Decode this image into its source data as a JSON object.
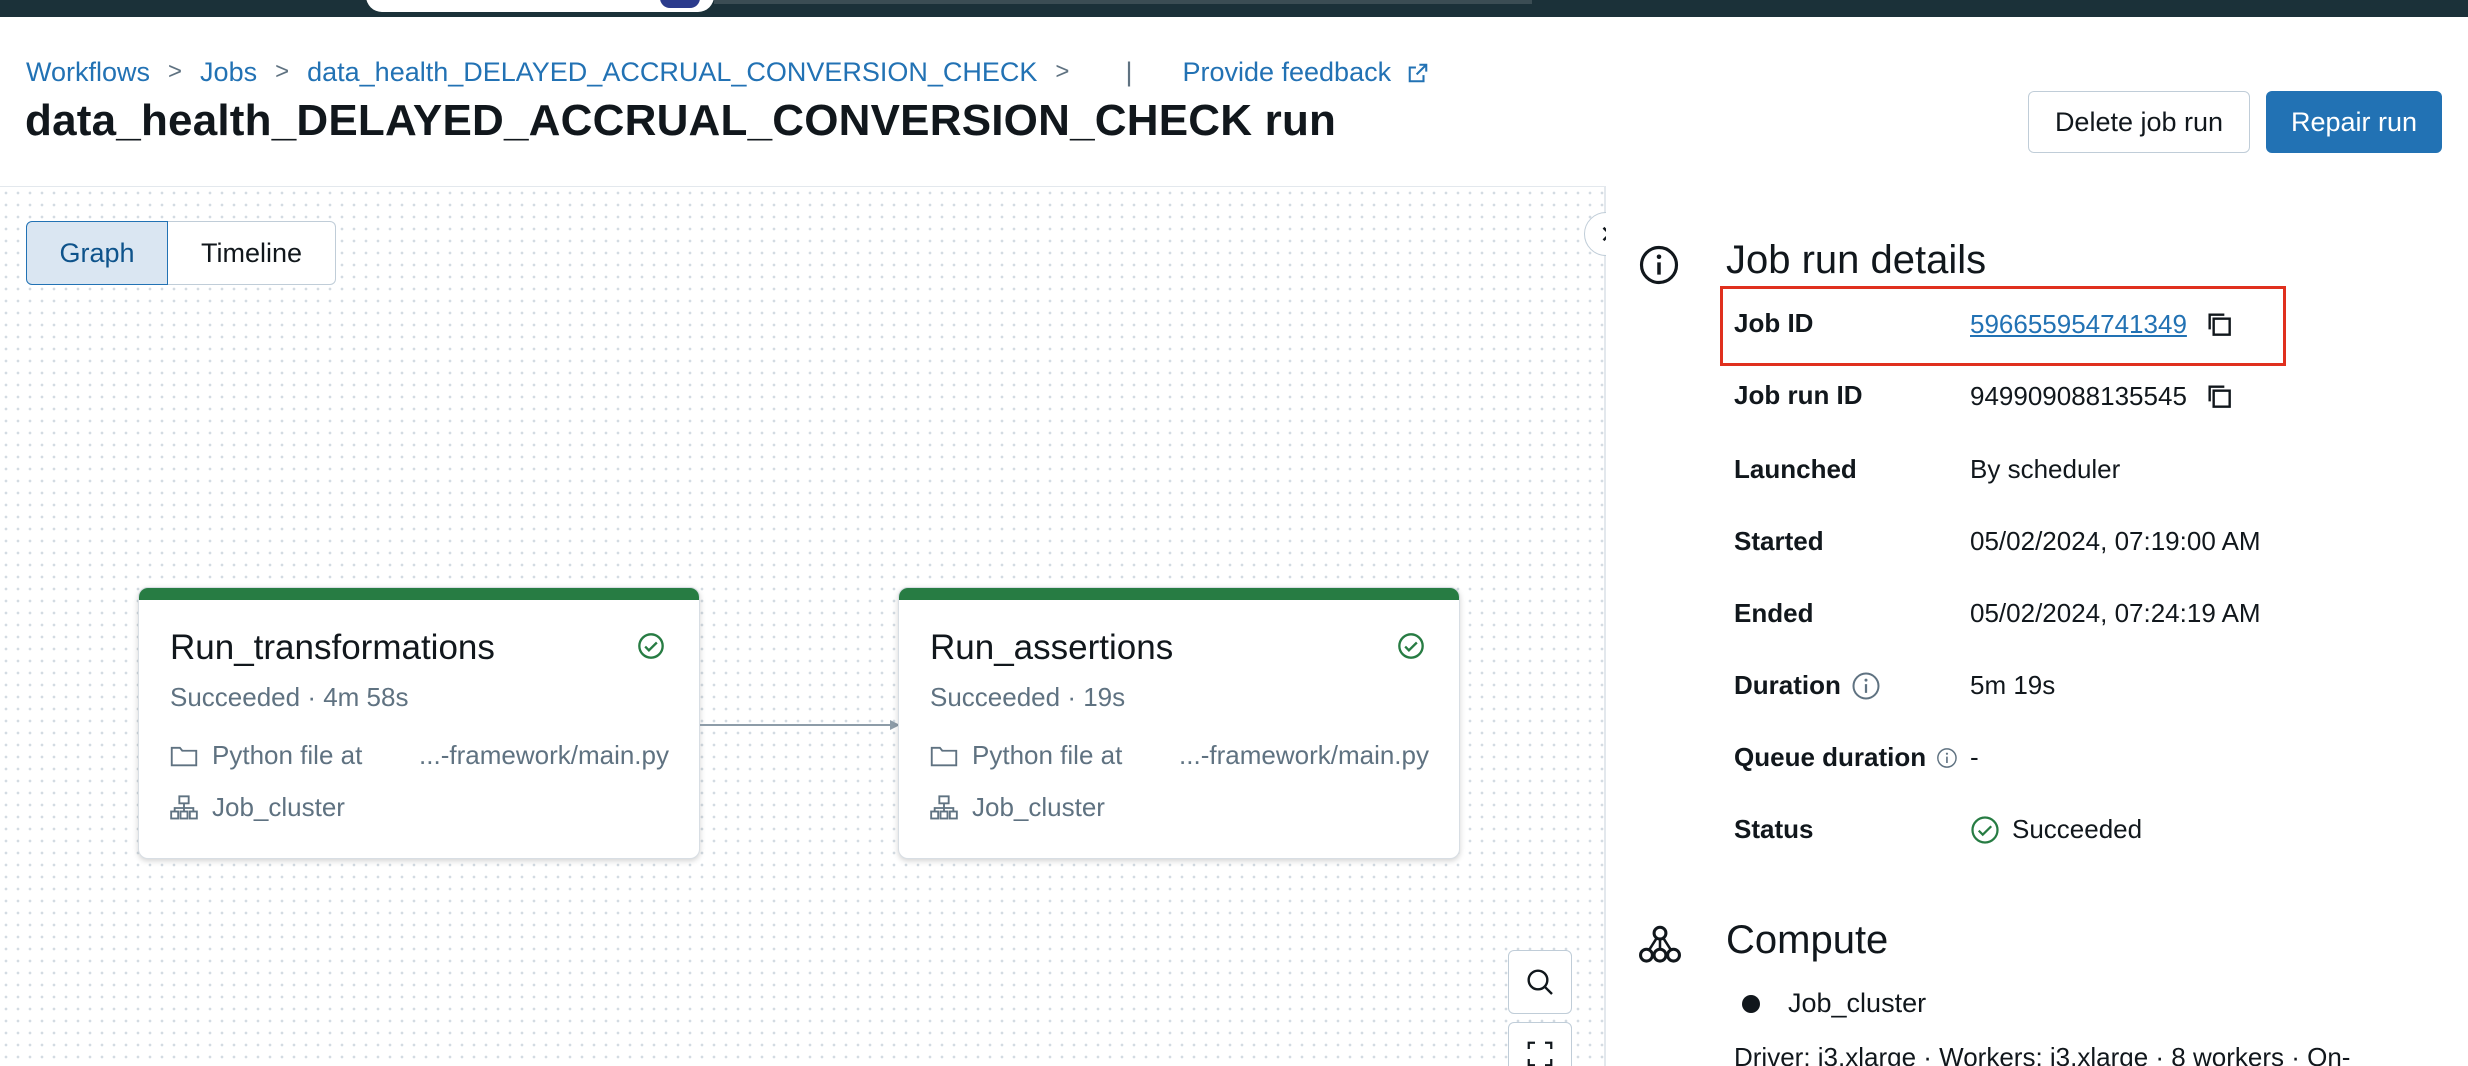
{
  "breadcrumb": {
    "items": [
      "Workflows",
      "Jobs",
      "data_health_DELAYED_ACCRUAL_CONVERSION_CHECK"
    ],
    "separator": ">",
    "bar": "|",
    "feedback": "Provide feedback"
  },
  "page": {
    "title": "data_health_DELAYED_ACCRUAL_CONVERSION_CHECK run"
  },
  "actions": {
    "delete_label": "Delete job run",
    "repair_label": "Repair run"
  },
  "view_toggle": {
    "graph": "Graph",
    "timeline": "Timeline",
    "selected": "Graph"
  },
  "tasks": [
    {
      "name": "Run_transformations",
      "status": "Succeeded · 4m 58s",
      "source": "Python file at",
      "path": "...-framework/main.py",
      "cluster": "Job_cluster"
    },
    {
      "name": "Run_assertions",
      "status": "Succeeded · 19s",
      "source": "Python file at",
      "path": "...-framework/main.py",
      "cluster": "Job_cluster"
    }
  ],
  "details": {
    "title": "Job run details",
    "job_id_label": "Job ID",
    "job_id": "596655954741349",
    "job_run_id_label": "Job run ID",
    "job_run_id": "949909088135545",
    "launched_label": "Launched",
    "launched": "By scheduler",
    "started_label": "Started",
    "started": "05/02/2024, 07:19:00 AM",
    "ended_label": "Ended",
    "ended": "05/02/2024, 07:24:19 AM",
    "duration_label": "Duration",
    "duration": "5m 19s",
    "queue_label": "Queue duration",
    "queue": "-",
    "status_label": "Status",
    "status": "Succeeded"
  },
  "compute": {
    "title": "Compute",
    "cluster": "Job_cluster",
    "driver": "Driver: i3.xlarge · Workers: i3.xlarge · 8 workers · On-"
  },
  "colors": {
    "link": "#2272b4",
    "primary": "#2272b4",
    "success": "#277c43",
    "highlight": "#e0301e",
    "topbar": "#1b3139"
  }
}
